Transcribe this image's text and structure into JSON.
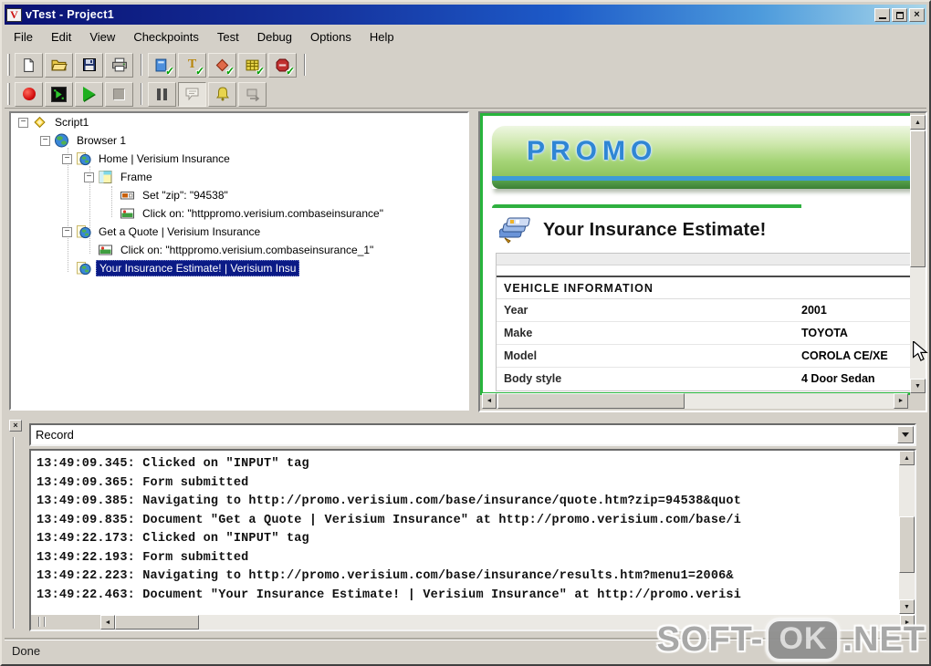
{
  "window": {
    "title": "vTest - Project1",
    "icon_letter": "V",
    "controls": [
      "minimize-icon",
      "maximize-icon",
      "close-icon"
    ],
    "status_text": "Done"
  },
  "colors": {
    "titlebar_start": "#0a1172",
    "titlebar_end": "#a9d6ea",
    "selection": "#0a1a86",
    "promo_green": "#28b43c",
    "promo_blue": "#2f86d4",
    "record_red": "#d41010"
  },
  "menu_bar": {
    "items": [
      "File",
      "Edit",
      "View",
      "Checkpoints",
      "Test",
      "Debug",
      "Options",
      "Help"
    ]
  },
  "toolbars": {
    "standard_icons": [
      "new-icon",
      "open-icon",
      "save-icon",
      "print-icon"
    ],
    "checkpoint_icons": [
      "page-checkpoint-icon",
      "text-checkpoint-icon",
      "image-checkpoint-icon",
      "table-checkpoint-icon",
      "stop-checkpoint-icon"
    ],
    "playback_icons": [
      "record-icon",
      "run-in-browser-icon",
      "play-icon",
      "stop-icon"
    ],
    "tool_icons": [
      "pause-icon",
      "comment-icon",
      "alert-icon",
      "sync-icon"
    ]
  },
  "script_tree": {
    "items": [
      {
        "label": "Script1",
        "icon": "script-icon",
        "depth": 0,
        "expanded": true
      },
      {
        "label": "Browser 1",
        "icon": "browser-icon",
        "depth": 1,
        "expanded": true
      },
      {
        "label": "Home | Verisium Insurance",
        "icon": "webpage-icon",
        "depth": 2,
        "expanded": true
      },
      {
        "label": "Frame",
        "icon": "frame-icon",
        "depth": 3,
        "expanded": true
      },
      {
        "label": "Set \"zip\": \"94538\"",
        "icon": "input-icon",
        "depth": 4,
        "expanded": null
      },
      {
        "label": "Click on: \"httppromo.verisium.combaseinsurance\"",
        "icon": "image-icon",
        "depth": 4,
        "expanded": null
      },
      {
        "label": "Get a Quote | Verisium Insurance",
        "icon": "webpage-icon",
        "depth": 2,
        "expanded": true
      },
      {
        "label": "Click on: \"httppromo.verisium.combaseinsurance_1\"",
        "icon": "image-icon",
        "depth": 3,
        "expanded": null
      },
      {
        "label": "Your Insurance Estimate! | Verisium Insu",
        "icon": "webpage-icon",
        "depth": 2,
        "expanded": null,
        "selected": true
      }
    ]
  },
  "browser_preview": {
    "banner_text": "PROMO",
    "heading": "Your Insurance Estimate!",
    "vehicle_table": {
      "section_header": "VEHICLE INFORMATION",
      "rows": [
        {
          "label": "Year",
          "value": "2001"
        },
        {
          "label": "Make",
          "value": "TOYOTA"
        },
        {
          "label": "Model",
          "value": "COROLA CE/XE"
        },
        {
          "label": "Body style",
          "value": "4 Door Sedan"
        }
      ]
    }
  },
  "log_panel": {
    "mode_selector_value": "Record",
    "entries": [
      "13:49:09.345: Clicked on \"INPUT\" tag",
      "13:49:09.365: Form submitted",
      "13:49:09.385: Navigating to http://promo.verisium.com/base/insurance/quote.htm?zip=94538&quot",
      "13:49:09.835: Document \"Get a Quote | Verisium Insurance\" at http://promo.verisium.com/base/i",
      "13:49:22.173: Clicked on \"INPUT\" tag",
      "13:49:22.193: Form submitted",
      "13:49:22.223: Navigating to http://promo.verisium.com/base/insurance/results.htm?menu1=2006&",
      "13:49:22.463: Document \"Your Insurance Estimate! | Verisium Insurance\" at http://promo.verisi"
    ]
  },
  "watermark": {
    "prefix": "SOFT-",
    "badge": "OK",
    "suffix": ".NET"
  }
}
